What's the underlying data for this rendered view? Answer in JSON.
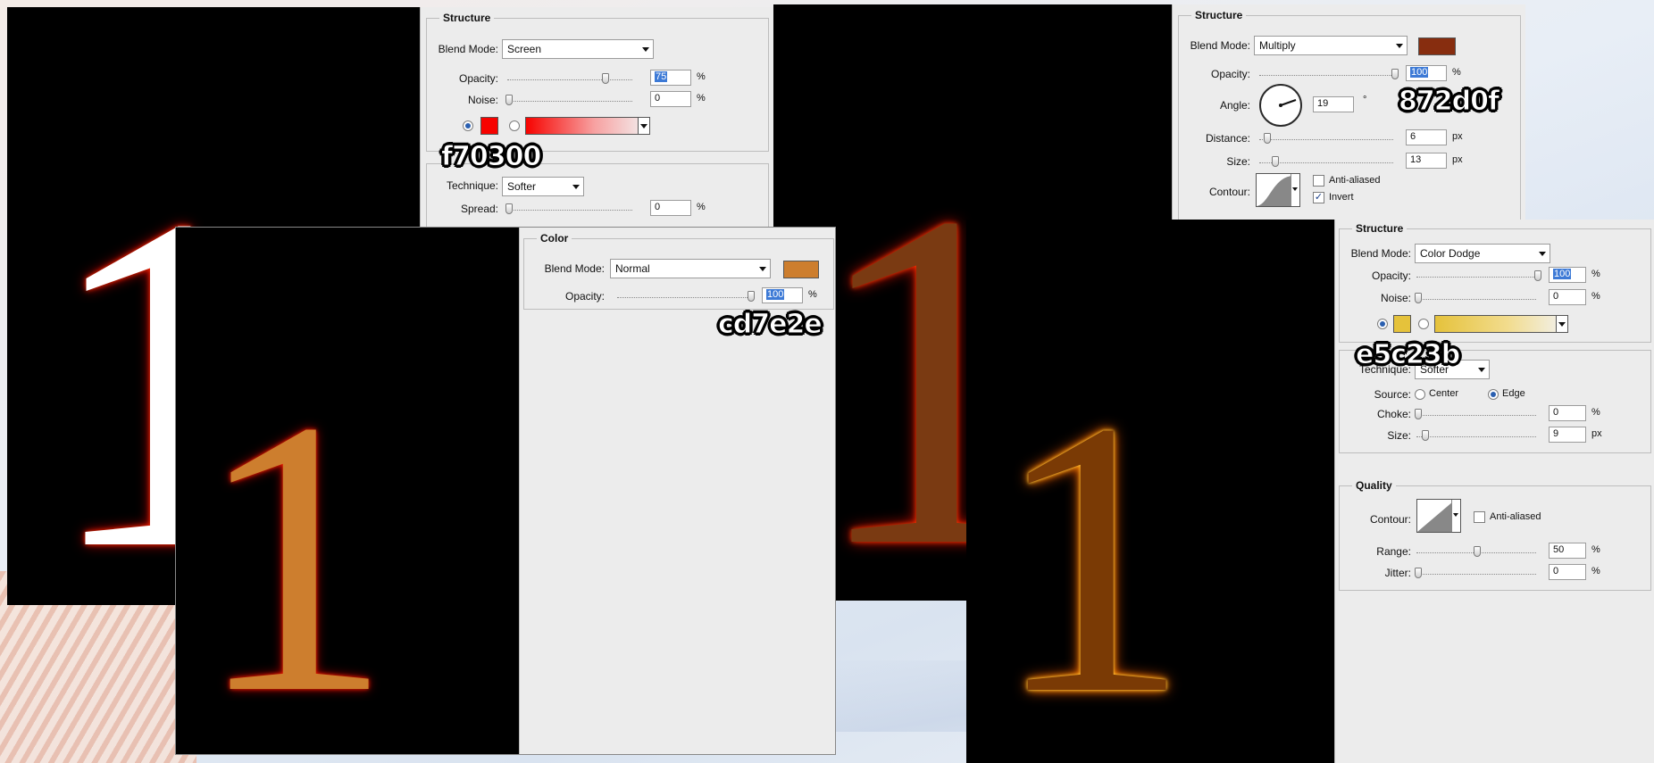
{
  "shot1": {
    "digit": "1",
    "structure": {
      "legend": "Structure",
      "blend_mode_label": "Blend Mode:",
      "blend_mode": "Screen",
      "opacity_label": "Opacity:",
      "opacity": "75",
      "noise_label": "Noise:",
      "noise": "0",
      "pct": "%"
    },
    "technique_label": "Technique:",
    "technique": "Softer",
    "spread_label": "Spread:",
    "spread": "0",
    "color_tag": "f70300",
    "swatch_color": "#f70300"
  },
  "shot2": {
    "digit": "1",
    "color": {
      "legend": "Color",
      "blend_mode_label": "Blend Mode:",
      "blend_mode": "Normal",
      "opacity_label": "Opacity:",
      "opacity": "100",
      "pct": "%"
    },
    "color_tag": "cd7e2e",
    "swatch_color": "#cd7e2e"
  },
  "shot3": {
    "digit": "1",
    "structure": {
      "legend": "Structure",
      "blend_mode_label": "Blend Mode:",
      "blend_mode": "Multiply",
      "opacity_label": "Opacity:",
      "opacity": "100",
      "pct": "%",
      "angle_label": "Angle:",
      "angle": "19",
      "degree": "°",
      "distance_label": "Distance:",
      "distance": "6",
      "size_label": "Size:",
      "size": "13",
      "px": "px",
      "contour_label": "Contour:",
      "anti_aliased": "Anti-aliased",
      "invert": "Invert"
    },
    "color_tag": "872d0f",
    "swatch_color": "#872d0f"
  },
  "shot4": {
    "digit": "1",
    "structure": {
      "legend": "Structure",
      "blend_mode_label": "Blend Mode:",
      "blend_mode": "Color Dodge",
      "opacity_label": "Opacity:",
      "opacity": "100",
      "noise_label": "Noise:",
      "noise": "0",
      "pct": "%"
    },
    "color_tag": "e5c23b",
    "swatch_color": "#e5c23b",
    "elements": {
      "technique_label": "Technique:",
      "technique": "Softer",
      "source_label": "Source:",
      "center": "Center",
      "edge": "Edge",
      "choke_label": "Choke:",
      "choke": "0",
      "size_label": "Size:",
      "size": "9",
      "px": "px",
      "pct": "%"
    },
    "quality": {
      "legend": "Quality",
      "contour_label": "Contour:",
      "anti_aliased": "Anti-aliased",
      "range_label": "Range:",
      "range": "50",
      "jitter_label": "Jitter:",
      "jitter": "0",
      "pct": "%"
    }
  }
}
